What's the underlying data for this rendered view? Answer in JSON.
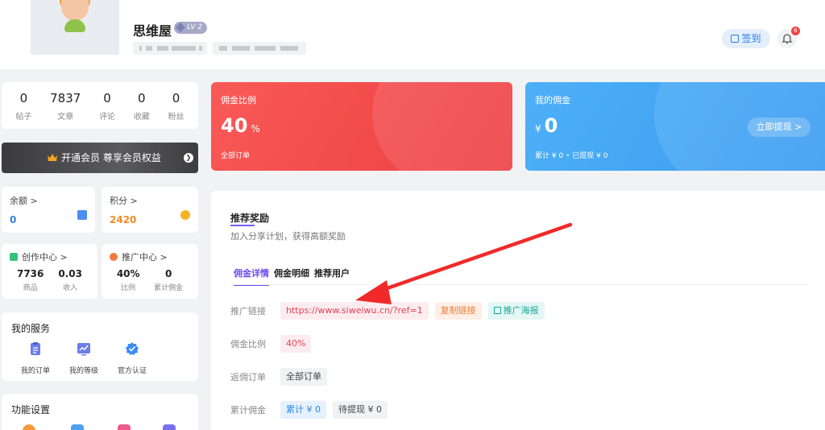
{
  "profile": {
    "username": "思维屋",
    "level": "LV 2"
  },
  "header": {
    "signin_label": "签到",
    "notifications_count": "6"
  },
  "stats": [
    {
      "value": "0",
      "label": "帖子"
    },
    {
      "value": "7837",
      "label": "文章"
    },
    {
      "value": "0",
      "label": "评论"
    },
    {
      "value": "0",
      "label": "收藏"
    },
    {
      "value": "0",
      "label": "粉丝"
    }
  ],
  "vip": {
    "label": "开通会员 尊享会员权益"
  },
  "balance": {
    "title": "余额 >",
    "value": "0"
  },
  "points": {
    "title": "积分 >",
    "value": "2420"
  },
  "creator": {
    "title": "创作中心 >",
    "items": [
      {
        "value": "7736",
        "label": "商品"
      },
      {
        "value": "0.03",
        "label": "收入"
      }
    ]
  },
  "promo": {
    "title": "推广中心 >",
    "items": [
      {
        "value": "40%",
        "label": "比例"
      },
      {
        "value": "0",
        "label": "累计佣金"
      }
    ]
  },
  "services": {
    "title": "我的服务",
    "items": [
      {
        "label": "我的订单",
        "icon": "clipboard-icon"
      },
      {
        "label": "我的等级",
        "icon": "chart-icon"
      },
      {
        "label": "官方认证",
        "icon": "verified-badge-icon"
      }
    ]
  },
  "settings": {
    "title": "功能设置"
  },
  "commission_rate_card": {
    "title": "佣金比例",
    "value": "40",
    "unit": "%",
    "footer": "全部订单"
  },
  "my_commission_card": {
    "title": "我的佣金",
    "currency": "¥",
    "value": "0",
    "footer_total": "累计 ¥ 0",
    "footer_withdrawn": "已提现 ¥ 0",
    "withdraw_label": "立即提现 >"
  },
  "referral": {
    "title": "推荐奖励",
    "subtitle": "加入分享计划，获得高额奖励",
    "tabs": [
      "佣金详情",
      "佣金明细",
      "推荐用户"
    ],
    "rows": {
      "link_label": "推广链接",
      "link_value": "https://www.siweiwu.cn/?ref=1",
      "copy_label": "复制链接",
      "poster_label": "推广海报",
      "rate_label": "佣金比例",
      "rate_value": "40%",
      "orders_label": "返佣订单",
      "orders_value": "全部订单",
      "total_label": "累计佣金",
      "total_value": "累计 ¥ 0",
      "pending_value": "待提现 ¥ 0"
    }
  },
  "colors": {
    "accent": "#6c4cf0",
    "red_card": "#f24a4a",
    "blue_card": "#3a9bf1",
    "arrow": "#f02a2a"
  }
}
